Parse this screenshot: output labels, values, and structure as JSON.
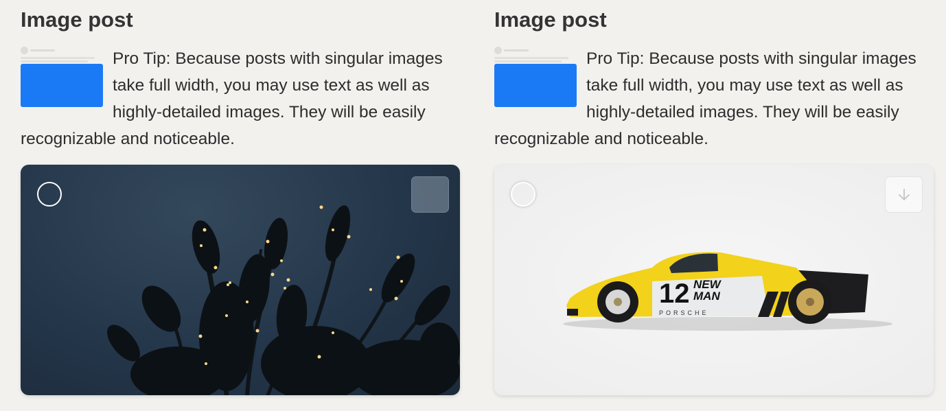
{
  "posts": [
    {
      "title": "Image post",
      "tip": "Pro Tip: Because posts with singular images take full width, you may use text as well as highly-detailed images. They will be easily recognizable and noticeable.",
      "image": "christmas-tree-lights-photo",
      "thumb_color": "#1a7af5"
    },
    {
      "title": "Image post",
      "tip": "Pro Tip: Because posts with singular images take full width, you may use text as well as highly-detailed images. They will be easily recognizable and noticeable.",
      "image": "race-car-photo",
      "thumb_color": "#1a7af5",
      "car": {
        "number": "12",
        "sponsor_lines": [
          "NEW",
          "MAN"
        ],
        "brand": "PORSCHE"
      }
    }
  ],
  "icons": {
    "select": "circle-select-icon",
    "download": "download-arrow-icon"
  },
  "colors": {
    "background": "#f2f1ee",
    "accent": "#1a7af5",
    "car_yellow": "#f2d21b"
  }
}
